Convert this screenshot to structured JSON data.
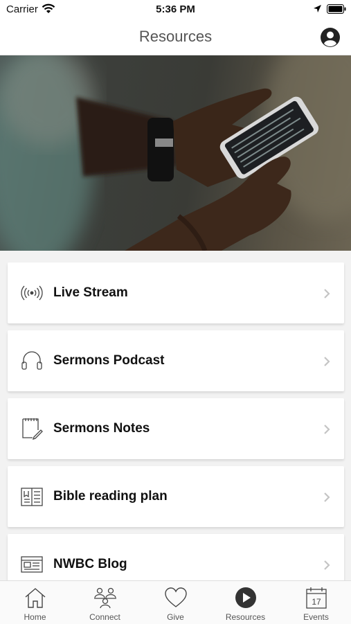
{
  "status_bar": {
    "carrier": "Carrier",
    "time": "5:36 PM"
  },
  "nav": {
    "title": "Resources"
  },
  "resources": [
    {
      "label": "Live Stream",
      "icon": "broadcast-icon"
    },
    {
      "label": "Sermons Podcast",
      "icon": "headphones-icon"
    },
    {
      "label": "Sermons Notes",
      "icon": "notes-icon"
    },
    {
      "label": "Bible reading plan",
      "icon": "book-icon"
    },
    {
      "label": "NWBC Blog",
      "icon": "blog-icon"
    }
  ],
  "tabs": [
    {
      "label": "Home",
      "icon": "home-icon"
    },
    {
      "label": "Connect",
      "icon": "people-icon"
    },
    {
      "label": "Give",
      "icon": "heart-icon"
    },
    {
      "label": "Resources",
      "icon": "play-icon",
      "active": true
    },
    {
      "label": "Events",
      "icon": "calendar-icon"
    }
  ],
  "colors": {
    "icon": "#444444",
    "chevron": "#c4c4c4",
    "active_tab_icon": "#333333"
  }
}
